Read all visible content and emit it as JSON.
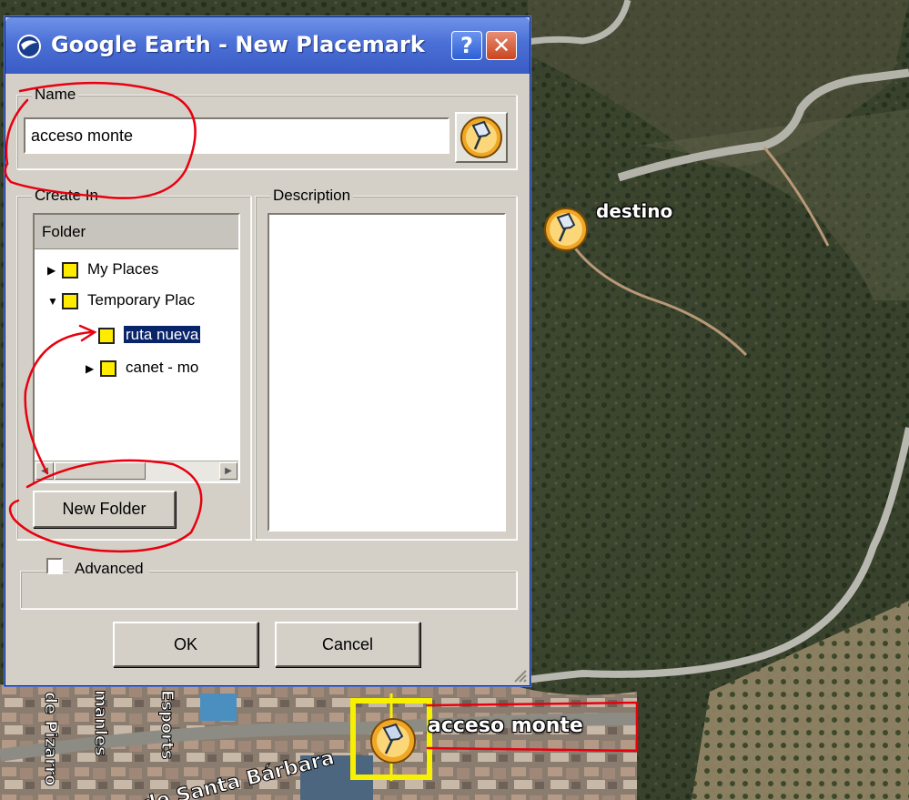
{
  "dialog": {
    "title": "Google Earth - New Placemark",
    "help_label": "?",
    "close_label": "✕",
    "name_label": "Name",
    "name_value": "acceso monte",
    "create_in_label": "Create In",
    "folder_column_header": "Folder",
    "tree": [
      {
        "label": "My Places",
        "expander": "▶",
        "selected": false
      },
      {
        "label": "Temporary Plac",
        "expander": "▼",
        "selected": false
      },
      {
        "label": "ruta nueva",
        "expander": "",
        "selected": true
      },
      {
        "label": "canet - mo",
        "expander": "▶",
        "selected": false
      }
    ],
    "new_folder_label": "New Folder",
    "description_label": "Description",
    "description_value": "",
    "advanced_label": "Advanced",
    "advanced_checked": false,
    "ok_label": "OK",
    "cancel_label": "Cancel"
  },
  "map": {
    "placemarks": [
      {
        "label": "destino",
        "icon": "pushpin-icon"
      },
      {
        "label": "acceso monte",
        "icon": "pushpin-icon",
        "selected": true
      }
    ],
    "street_labels": [
      "de Santa Bárbara",
      "de Pizarro",
      "manles",
      "Esports"
    ]
  },
  "colors": {
    "titlebar": "#4b70d6",
    "dialog_bg": "#d4d0c8",
    "selection": "#0a246a",
    "folder_icon": "#ffec00",
    "annotation": "#e8000f",
    "placemark_highlight": "#f7f000"
  }
}
